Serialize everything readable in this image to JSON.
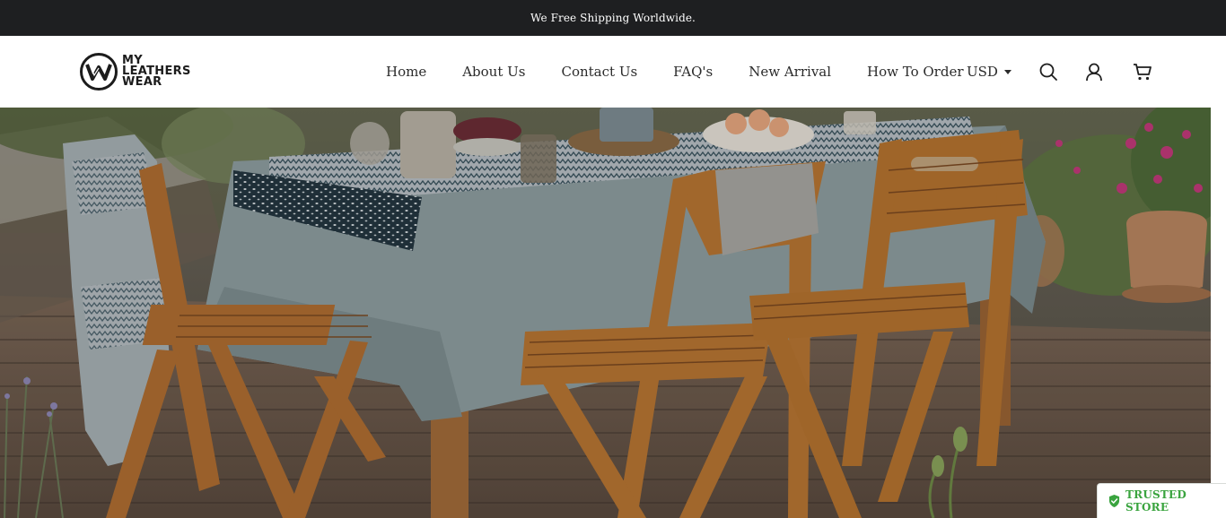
{
  "announcement": {
    "text": "We Free Shipping Worldwide."
  },
  "logo": {
    "lines": [
      "MY",
      "LEATHERS",
      "WEAR"
    ],
    "icon": "logo-mark"
  },
  "nav": [
    {
      "label": "Home"
    },
    {
      "label": "About Us"
    },
    {
      "label": "Contact Us"
    },
    {
      "label": "FAQ's"
    },
    {
      "label": "New Arrival"
    },
    {
      "label": "How To Order"
    }
  ],
  "currency": {
    "selected": "USD"
  },
  "header_icons": [
    "search-icon",
    "account-icon",
    "cart-icon"
  ],
  "hero": {
    "image": "outdoor-dining-table-with-wooden-chairs"
  },
  "badge": {
    "text": "TRUSTED STORE",
    "icon": "shield-check-icon",
    "color": "#3aa43f"
  },
  "colors": {
    "announcement_bg": "#1e1f21",
    "text": "#2b2b2b"
  }
}
